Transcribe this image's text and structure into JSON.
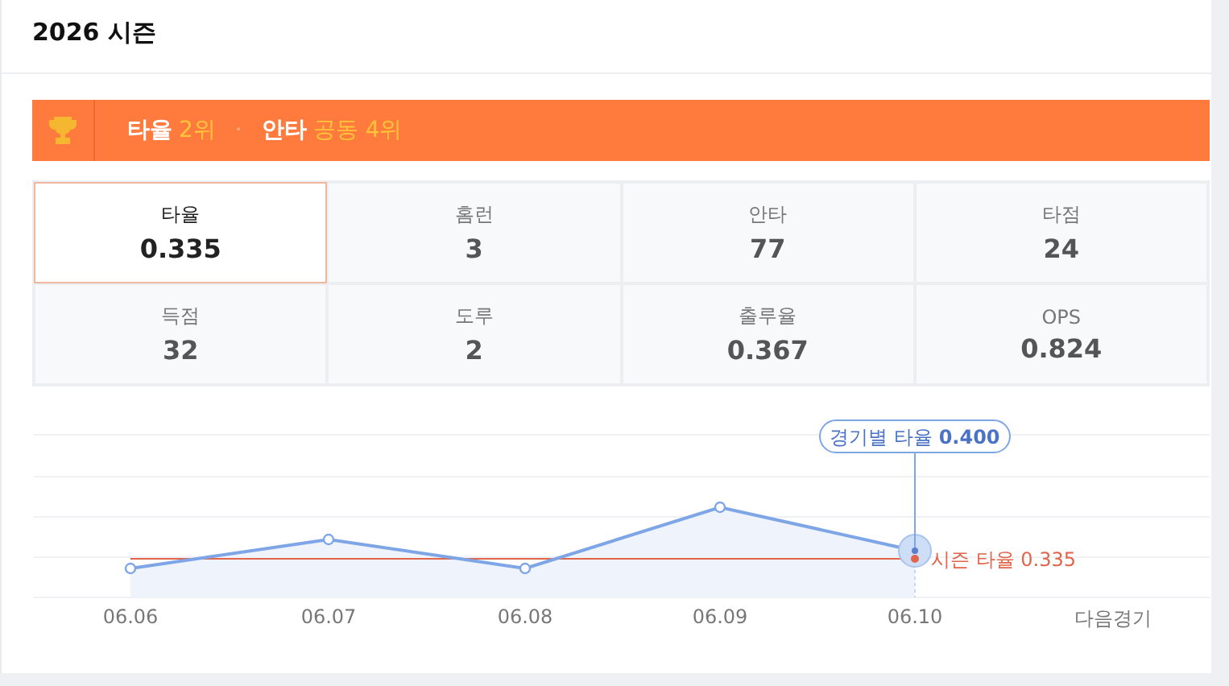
{
  "title": "2026 시즌",
  "ranking_banner": {
    "separator": "·",
    "ranks": [
      {
        "stat": "타율",
        "rank": "2위"
      },
      {
        "stat": "안타",
        "rank": "공동 4위"
      }
    ]
  },
  "stats": [
    {
      "label": "타율",
      "value": "0.335",
      "selected": true
    },
    {
      "label": "홈런",
      "value": "3",
      "selected": false
    },
    {
      "label": "안타",
      "value": "77",
      "selected": false
    },
    {
      "label": "타점",
      "value": "24",
      "selected": false
    },
    {
      "label": "득점",
      "value": "32",
      "selected": false
    },
    {
      "label": "도루",
      "value": "2",
      "selected": false
    },
    {
      "label": "출루율",
      "value": "0.367",
      "selected": false
    },
    {
      "label": "OPS",
      "value": "0.824",
      "selected": false
    }
  ],
  "trend": {
    "tooltip": {
      "label": "경기별 타율",
      "value": "0.400"
    },
    "season_label": "시즌 타율 0.335",
    "dates": [
      "06.06",
      "06.07",
      "06.08",
      "06.09",
      "06.10"
    ],
    "next_label": "다음경기"
  }
}
